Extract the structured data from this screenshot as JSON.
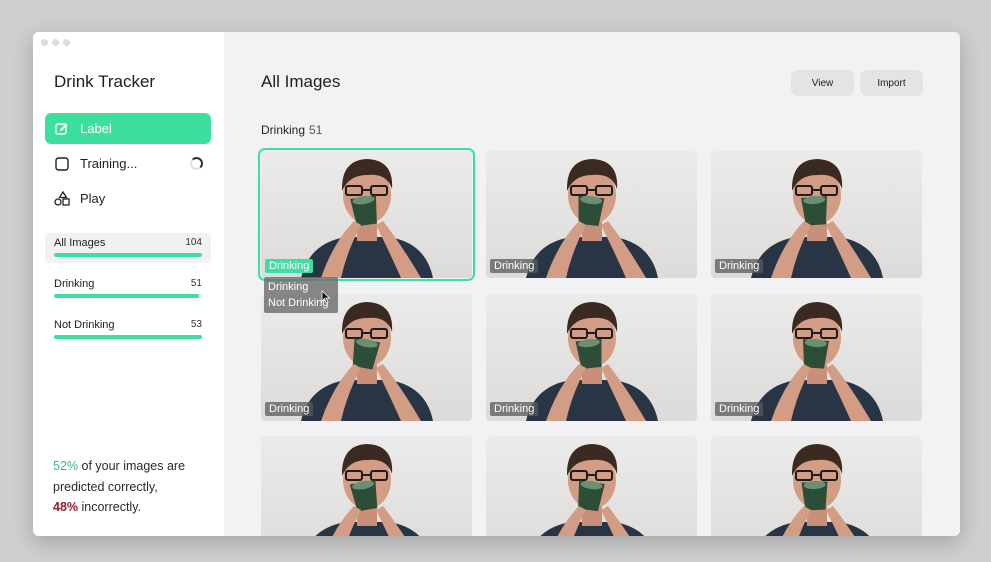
{
  "app": {
    "title": "Drink Tracker"
  },
  "sidebar": {
    "nav": [
      {
        "label": "Label",
        "icon": "edit-icon",
        "active": true
      },
      {
        "label": "Training...",
        "icon": "square-icon",
        "active": false
      },
      {
        "label": "Play",
        "icon": "shapes-icon",
        "active": false
      }
    ],
    "categories": [
      {
        "label": "All Images",
        "count": "104",
        "progress": 1.0
      },
      {
        "label": "Drinking",
        "count": "51",
        "progress": 0.98
      },
      {
        "label": "Not Drinking",
        "count": "53",
        "progress": 1.0
      }
    ],
    "stats": {
      "correct_pct": "52%",
      "correct_text": " of your images are predicted correctly,",
      "incorrect_pct": "48%",
      "incorrect_text": " incorrectly."
    }
  },
  "main": {
    "title": "All Images",
    "buttons": {
      "view": "View",
      "import": "Import"
    },
    "section": {
      "label": "Drinking",
      "count": "51"
    },
    "images": [
      {
        "label": "Drinking"
      },
      {
        "label": "Drinking"
      },
      {
        "label": "Drinking"
      },
      {
        "label": "Drinking"
      },
      {
        "label": "Drinking"
      },
      {
        "label": "Drinking"
      },
      {
        "label": ""
      },
      {
        "label": ""
      },
      {
        "label": ""
      }
    ],
    "dropdown": {
      "options": [
        "Drinking",
        "Not Drinking"
      ]
    }
  },
  "colors": {
    "accent": "#3ddf9e",
    "correct": "#3ab48a",
    "incorrect": "#8f1d2e"
  }
}
